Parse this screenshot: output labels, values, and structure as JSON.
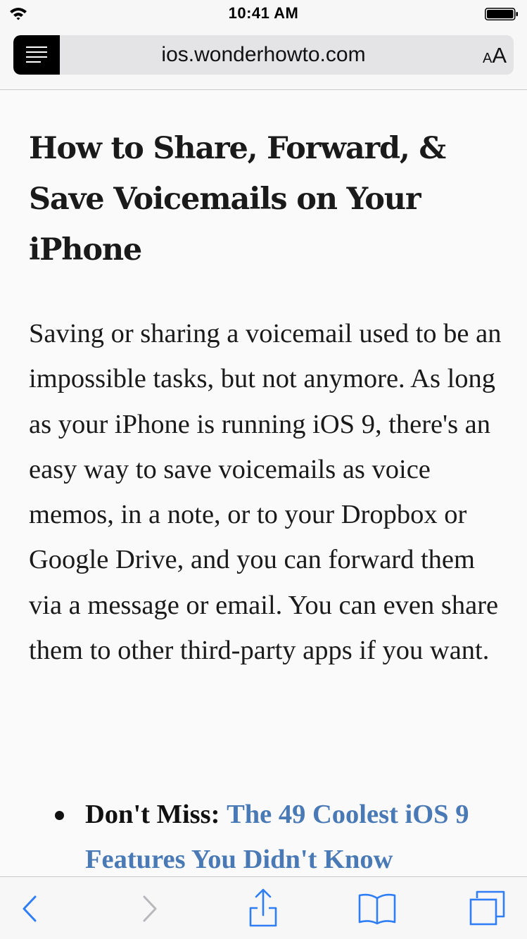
{
  "status_bar": {
    "time": "10:41 AM",
    "wifi_icon": "wifi-icon",
    "battery_icon": "battery-icon"
  },
  "address_bar": {
    "reader_icon": "reader-view-icon",
    "url": "ios.wonderhowto.com",
    "text_size_small": "A",
    "text_size_large": "A"
  },
  "article": {
    "title": "How to Share, Forward, & Save Voicemails on Your iPhone",
    "body": "Saving or sharing a voicemail used to be an impossible tasks, but not anymore. As long as your iPhone is running iOS 9, there's an easy way to save voicemails as voice memos, in a note, or to your Dropbox or Google Drive, and you can forward them via a message or email. You can even share them to other third-party apps if you want.",
    "bullets": [
      {
        "label": "Don't Miss:",
        "link_text": "The 49 Coolest iOS 9 Features You Didn't Know"
      }
    ]
  },
  "toolbar": {
    "back_icon": "back-chevron-icon",
    "forward_icon": "forward-chevron-icon",
    "share_icon": "share-icon",
    "bookmarks_icon": "bookmarks-book-icon",
    "tabs_icon": "tabs-icon",
    "accent_color": "#2f7ef6",
    "disabled_color": "#b7b7bc"
  },
  "colors": {
    "link": "#4a7ab5",
    "reader_background": "#fafafa",
    "bar_background": "#f7f7f7"
  }
}
